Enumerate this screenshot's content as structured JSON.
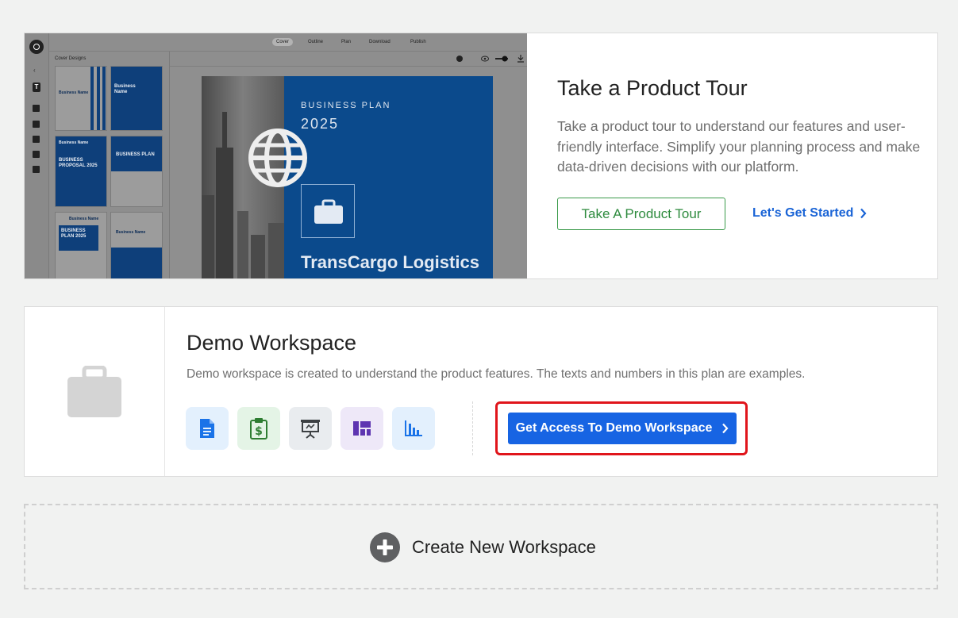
{
  "tour": {
    "title": "Take a Product Tour",
    "description": "Take a product tour to understand our features and user-friendly interface. Simplify your planning process and make data-driven decisions with our platform.",
    "button_label": "Take A Product Tour",
    "link_label": "Let's Get Started"
  },
  "preview": {
    "tabs": [
      "Cover",
      "Outline",
      "Plan",
      "Download",
      "Publish"
    ],
    "active_tab": "Cover",
    "sidebar_title": "Cover Designs",
    "rail_letter": "T",
    "cover": {
      "kicker": "BUSINESS PLAN",
      "year": "2025",
      "company": "TransCargo Logistics"
    },
    "thumbs": [
      {
        "title": "Business Name"
      },
      {
        "title": "Business Name"
      },
      {
        "title": "BUSINESS PROPOSAL 2025",
        "header": "Business Name"
      },
      {
        "title": "BUSINESS PLAN"
      },
      {
        "title": "BUSINESS PLAN 2025",
        "header": "Business Name"
      },
      {
        "title": "Business Name"
      }
    ]
  },
  "demo": {
    "title": "Demo Workspace",
    "description": "Demo workspace is created to understand the product features. The texts and numbers in this plan are examples.",
    "access_button_label": "Get Access To Demo Workspace",
    "features": [
      {
        "icon": "document-icon",
        "bg": "#e3f0fd",
        "color": "#1a73e8"
      },
      {
        "icon": "financial-clipboard-icon",
        "bg": "#e4f4e6",
        "color": "#2e7d32"
      },
      {
        "icon": "presentation-icon",
        "bg": "#e9ecef",
        "color": "#3c4043"
      },
      {
        "icon": "dashboard-icon",
        "bg": "#eee8f8",
        "color": "#5e35b1"
      },
      {
        "icon": "bar-chart-icon",
        "bg": "#e3f0fd",
        "color": "#1a73e8"
      }
    ]
  },
  "create": {
    "label": "Create New Workspace"
  },
  "colors": {
    "primary_blue": "#1764e3",
    "tour_green": "#2e8b3e",
    "highlight_red": "#e0151b"
  }
}
